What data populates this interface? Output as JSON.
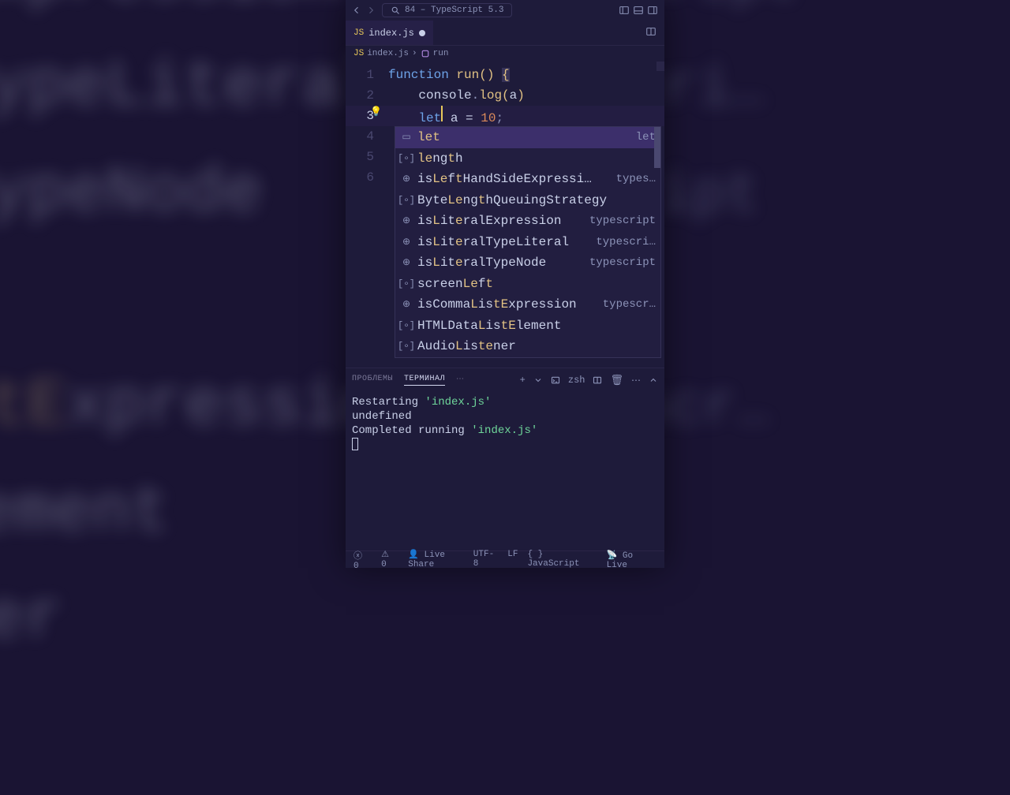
{
  "titlebar": {
    "project": "84 – TypeScript 5.3"
  },
  "tab": {
    "filename": "index.js"
  },
  "breadcrumb": {
    "file": "index.js",
    "symbol": "run"
  },
  "code": {
    "lines": [
      {
        "n": 1,
        "tokens": [
          [
            "kw",
            "function"
          ],
          [
            "txt",
            " "
          ],
          [
            "fn",
            "run"
          ],
          [
            "punc",
            "()"
          ],
          [
            "txt",
            " "
          ],
          [
            "punc",
            "{"
          ]
        ]
      },
      {
        "n": 2,
        "tokens": [
          [
            "txt",
            "    "
          ],
          [
            "var",
            "console"
          ],
          [
            "dot",
            "."
          ],
          [
            "fn",
            "log"
          ],
          [
            "punc",
            "("
          ],
          [
            "var",
            "a"
          ],
          [
            "punc",
            ")"
          ]
        ]
      },
      {
        "n": 3,
        "tokens": [
          [
            "txt",
            "    "
          ],
          [
            "kw",
            "let"
          ],
          [
            "cursor",
            ""
          ],
          [
            "txt",
            " "
          ],
          [
            "var",
            "a"
          ],
          [
            "txt",
            " = "
          ],
          [
            "num",
            "10"
          ],
          [
            "dot",
            ";"
          ]
        ]
      },
      {
        "n": 4,
        "tokens": []
      },
      {
        "n": 5,
        "tokens": []
      },
      {
        "n": 6,
        "tokens": []
      }
    ],
    "active_line": 3
  },
  "suggest": {
    "items": [
      {
        "icon": "keyword",
        "parts": [
          [
            "m",
            "let"
          ]
        ],
        "detail": "let",
        "selected": true
      },
      {
        "icon": "variable",
        "parts": [
          [
            "m",
            "le"
          ],
          [
            "",
            "ng"
          ],
          [
            "m",
            "t"
          ],
          [
            "",
            "h"
          ]
        ],
        "detail": ""
      },
      {
        "icon": "function",
        "parts": [
          [
            "",
            "is"
          ],
          [
            "m",
            "Le"
          ],
          [
            "",
            "f"
          ],
          [
            "m",
            "t"
          ],
          [
            "",
            "HandSideExpressi…"
          ]
        ],
        "detail": "types…"
      },
      {
        "icon": "variable",
        "parts": [
          [
            "",
            "Byte"
          ],
          [
            "m",
            "Le"
          ],
          [
            "",
            "ng"
          ],
          [
            "m",
            "t"
          ],
          [
            "",
            "hQueuingStrategy"
          ]
        ],
        "detail": ""
      },
      {
        "icon": "function",
        "parts": [
          [
            "",
            "is"
          ],
          [
            "m",
            "L"
          ],
          [
            "",
            "it"
          ],
          [
            "m",
            "e"
          ],
          [
            "",
            "ralExpression"
          ]
        ],
        "detail": "typescript"
      },
      {
        "icon": "function",
        "parts": [
          [
            "",
            "is"
          ],
          [
            "m",
            "L"
          ],
          [
            "",
            "it"
          ],
          [
            "m",
            "e"
          ],
          [
            "",
            "ralTypeLiteral"
          ]
        ],
        "detail": "typescri…"
      },
      {
        "icon": "function",
        "parts": [
          [
            "",
            "is"
          ],
          [
            "m",
            "L"
          ],
          [
            "",
            "it"
          ],
          [
            "m",
            "e"
          ],
          [
            "",
            "ralTypeNode"
          ]
        ],
        "detail": "typescript"
      },
      {
        "icon": "variable",
        "parts": [
          [
            "",
            "screen"
          ],
          [
            "m",
            "Le"
          ],
          [
            "",
            "f"
          ],
          [
            "m",
            "t"
          ]
        ],
        "detail": ""
      },
      {
        "icon": "function",
        "parts": [
          [
            "",
            "isComma"
          ],
          [
            "m",
            "L"
          ],
          [
            "",
            "is"
          ],
          [
            "m",
            "tE"
          ],
          [
            "",
            "xpression"
          ]
        ],
        "detail": "typescr…"
      },
      {
        "icon": "variable",
        "parts": [
          [
            "",
            "HTMLData"
          ],
          [
            "m",
            "L"
          ],
          [
            "",
            "is"
          ],
          [
            "m",
            "tE"
          ],
          [
            "",
            "lement"
          ]
        ],
        "detail": ""
      },
      {
        "icon": "variable",
        "parts": [
          [
            "",
            "Audio"
          ],
          [
            "m",
            "L"
          ],
          [
            "",
            "is"
          ],
          [
            "m",
            "te"
          ],
          [
            "",
            "ner"
          ]
        ],
        "detail": ""
      }
    ]
  },
  "panel": {
    "tabs": {
      "problems": "ПРОБЛЕМЫ",
      "terminal": "ТЕРМИНАЛ"
    },
    "shell": "zsh",
    "terminal_lines": [
      {
        "style": "green",
        "parts": [
          [
            "gray",
            "Restarting "
          ],
          [
            "green",
            "'index.js'"
          ]
        ]
      },
      {
        "style": "gray",
        "parts": [
          [
            "gray",
            "undefined"
          ]
        ]
      },
      {
        "style": "green",
        "parts": [
          [
            "gray",
            "Completed running "
          ],
          [
            "green",
            "'index.js'"
          ]
        ]
      }
    ]
  },
  "statusbar": {
    "errors": "0",
    "warnings": "0",
    "live_share": "Live Share",
    "encoding": "UTF-8",
    "eol": "LF",
    "lang": "JavaScript",
    "golive": "Go Live"
  }
}
